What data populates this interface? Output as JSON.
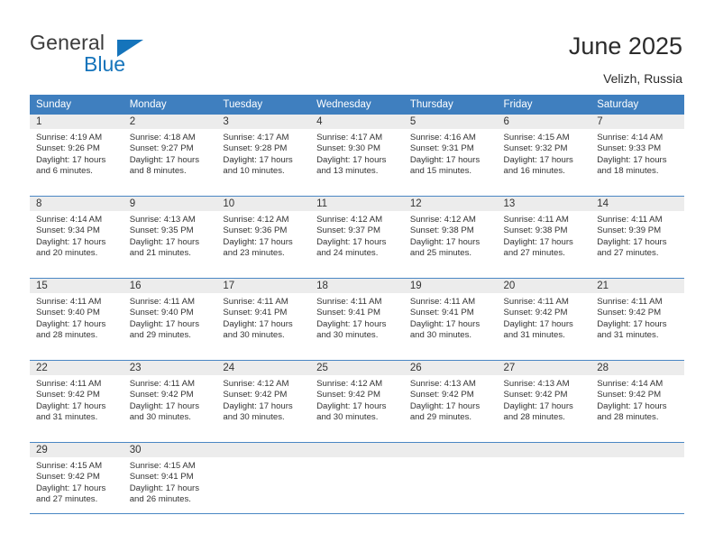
{
  "brand": {
    "line1": "General",
    "line2": "Blue",
    "triangle_icon": "brand-triangle-icon",
    "color_dark": "#3b3b3b",
    "color_blue": "#1574bb"
  },
  "header": {
    "title": "June 2025",
    "subtitle": "Velizh, Russia"
  },
  "calendar": {
    "header_bg": "#3f7fbf",
    "daynum_bg": "#ececec",
    "grid_line": "#4a87c4",
    "weekdays": [
      "Sunday",
      "Monday",
      "Tuesday",
      "Wednesday",
      "Thursday",
      "Friday",
      "Saturday"
    ],
    "weeks": [
      [
        {
          "day": "1",
          "sunrise": "Sunrise: 4:19 AM",
          "sunset": "Sunset: 9:26 PM",
          "daylight1": "Daylight: 17 hours",
          "daylight2": "and 6 minutes."
        },
        {
          "day": "2",
          "sunrise": "Sunrise: 4:18 AM",
          "sunset": "Sunset: 9:27 PM",
          "daylight1": "Daylight: 17 hours",
          "daylight2": "and 8 minutes."
        },
        {
          "day": "3",
          "sunrise": "Sunrise: 4:17 AM",
          "sunset": "Sunset: 9:28 PM",
          "daylight1": "Daylight: 17 hours",
          "daylight2": "and 10 minutes."
        },
        {
          "day": "4",
          "sunrise": "Sunrise: 4:17 AM",
          "sunset": "Sunset: 9:30 PM",
          "daylight1": "Daylight: 17 hours",
          "daylight2": "and 13 minutes."
        },
        {
          "day": "5",
          "sunrise": "Sunrise: 4:16 AM",
          "sunset": "Sunset: 9:31 PM",
          "daylight1": "Daylight: 17 hours",
          "daylight2": "and 15 minutes."
        },
        {
          "day": "6",
          "sunrise": "Sunrise: 4:15 AM",
          "sunset": "Sunset: 9:32 PM",
          "daylight1": "Daylight: 17 hours",
          "daylight2": "and 16 minutes."
        },
        {
          "day": "7",
          "sunrise": "Sunrise: 4:14 AM",
          "sunset": "Sunset: 9:33 PM",
          "daylight1": "Daylight: 17 hours",
          "daylight2": "and 18 minutes."
        }
      ],
      [
        {
          "day": "8",
          "sunrise": "Sunrise: 4:14 AM",
          "sunset": "Sunset: 9:34 PM",
          "daylight1": "Daylight: 17 hours",
          "daylight2": "and 20 minutes."
        },
        {
          "day": "9",
          "sunrise": "Sunrise: 4:13 AM",
          "sunset": "Sunset: 9:35 PM",
          "daylight1": "Daylight: 17 hours",
          "daylight2": "and 21 minutes."
        },
        {
          "day": "10",
          "sunrise": "Sunrise: 4:12 AM",
          "sunset": "Sunset: 9:36 PM",
          "daylight1": "Daylight: 17 hours",
          "daylight2": "and 23 minutes."
        },
        {
          "day": "11",
          "sunrise": "Sunrise: 4:12 AM",
          "sunset": "Sunset: 9:37 PM",
          "daylight1": "Daylight: 17 hours",
          "daylight2": "and 24 minutes."
        },
        {
          "day": "12",
          "sunrise": "Sunrise: 4:12 AM",
          "sunset": "Sunset: 9:38 PM",
          "daylight1": "Daylight: 17 hours",
          "daylight2": "and 25 minutes."
        },
        {
          "day": "13",
          "sunrise": "Sunrise: 4:11 AM",
          "sunset": "Sunset: 9:38 PM",
          "daylight1": "Daylight: 17 hours",
          "daylight2": "and 27 minutes."
        },
        {
          "day": "14",
          "sunrise": "Sunrise: 4:11 AM",
          "sunset": "Sunset: 9:39 PM",
          "daylight1": "Daylight: 17 hours",
          "daylight2": "and 27 minutes."
        }
      ],
      [
        {
          "day": "15",
          "sunrise": "Sunrise: 4:11 AM",
          "sunset": "Sunset: 9:40 PM",
          "daylight1": "Daylight: 17 hours",
          "daylight2": "and 28 minutes."
        },
        {
          "day": "16",
          "sunrise": "Sunrise: 4:11 AM",
          "sunset": "Sunset: 9:40 PM",
          "daylight1": "Daylight: 17 hours",
          "daylight2": "and 29 minutes."
        },
        {
          "day": "17",
          "sunrise": "Sunrise: 4:11 AM",
          "sunset": "Sunset: 9:41 PM",
          "daylight1": "Daylight: 17 hours",
          "daylight2": "and 30 minutes."
        },
        {
          "day": "18",
          "sunrise": "Sunrise: 4:11 AM",
          "sunset": "Sunset: 9:41 PM",
          "daylight1": "Daylight: 17 hours",
          "daylight2": "and 30 minutes."
        },
        {
          "day": "19",
          "sunrise": "Sunrise: 4:11 AM",
          "sunset": "Sunset: 9:41 PM",
          "daylight1": "Daylight: 17 hours",
          "daylight2": "and 30 minutes."
        },
        {
          "day": "20",
          "sunrise": "Sunrise: 4:11 AM",
          "sunset": "Sunset: 9:42 PM",
          "daylight1": "Daylight: 17 hours",
          "daylight2": "and 31 minutes."
        },
        {
          "day": "21",
          "sunrise": "Sunrise: 4:11 AM",
          "sunset": "Sunset: 9:42 PM",
          "daylight1": "Daylight: 17 hours",
          "daylight2": "and 31 minutes."
        }
      ],
      [
        {
          "day": "22",
          "sunrise": "Sunrise: 4:11 AM",
          "sunset": "Sunset: 9:42 PM",
          "daylight1": "Daylight: 17 hours",
          "daylight2": "and 31 minutes."
        },
        {
          "day": "23",
          "sunrise": "Sunrise: 4:11 AM",
          "sunset": "Sunset: 9:42 PM",
          "daylight1": "Daylight: 17 hours",
          "daylight2": "and 30 minutes."
        },
        {
          "day": "24",
          "sunrise": "Sunrise: 4:12 AM",
          "sunset": "Sunset: 9:42 PM",
          "daylight1": "Daylight: 17 hours",
          "daylight2": "and 30 minutes."
        },
        {
          "day": "25",
          "sunrise": "Sunrise: 4:12 AM",
          "sunset": "Sunset: 9:42 PM",
          "daylight1": "Daylight: 17 hours",
          "daylight2": "and 30 minutes."
        },
        {
          "day": "26",
          "sunrise": "Sunrise: 4:13 AM",
          "sunset": "Sunset: 9:42 PM",
          "daylight1": "Daylight: 17 hours",
          "daylight2": "and 29 minutes."
        },
        {
          "day": "27",
          "sunrise": "Sunrise: 4:13 AM",
          "sunset": "Sunset: 9:42 PM",
          "daylight1": "Daylight: 17 hours",
          "daylight2": "and 28 minutes."
        },
        {
          "day": "28",
          "sunrise": "Sunrise: 4:14 AM",
          "sunset": "Sunset: 9:42 PM",
          "daylight1": "Daylight: 17 hours",
          "daylight2": "and 28 minutes."
        }
      ],
      [
        {
          "day": "29",
          "sunrise": "Sunrise: 4:15 AM",
          "sunset": "Sunset: 9:42 PM",
          "daylight1": "Daylight: 17 hours",
          "daylight2": "and 27 minutes."
        },
        {
          "day": "30",
          "sunrise": "Sunrise: 4:15 AM",
          "sunset": "Sunset: 9:41 PM",
          "daylight1": "Daylight: 17 hours",
          "daylight2": "and 26 minutes."
        },
        {
          "day": "",
          "sunrise": "",
          "sunset": "",
          "daylight1": "",
          "daylight2": ""
        },
        {
          "day": "",
          "sunrise": "",
          "sunset": "",
          "daylight1": "",
          "daylight2": ""
        },
        {
          "day": "",
          "sunrise": "",
          "sunset": "",
          "daylight1": "",
          "daylight2": ""
        },
        {
          "day": "",
          "sunrise": "",
          "sunset": "",
          "daylight1": "",
          "daylight2": ""
        },
        {
          "day": "",
          "sunrise": "",
          "sunset": "",
          "daylight1": "",
          "daylight2": ""
        }
      ]
    ]
  }
}
